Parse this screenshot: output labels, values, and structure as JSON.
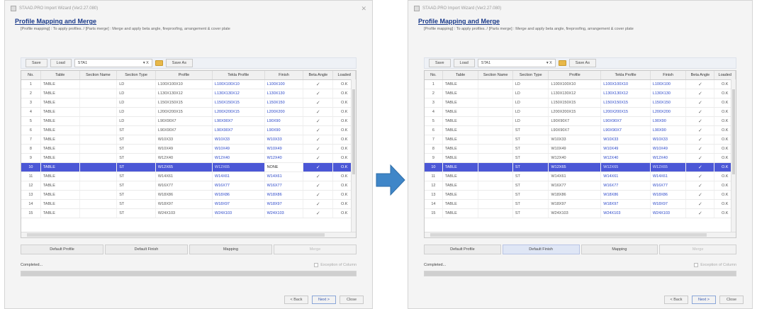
{
  "windows": [
    {
      "title": "STAAD.PRO Import Wizard (Ver2.27.080)",
      "heading": "Profile Mapping and Merge",
      "description": "[Profile mapping] : To apply profiles. / [Parts merge] : Merge and apply beta angle, fireproofing, arrangement & cover plate",
      "toolbar": {
        "save": "Save",
        "load": "Load",
        "combo_value": "STA1",
        "combo_suffix": "▾ X",
        "save_as": "Save As"
      },
      "columns": [
        "No.",
        "Table",
        "Section Name",
        "Section Type",
        "Profile",
        "Tekla Profile",
        "Finish",
        "Beta Angle",
        "Loaded"
      ],
      "rows": [
        [
          "1",
          "TABLE",
          "",
          "LD",
          "L100X100X10",
          "L100X100X10",
          "L100X100",
          "✓",
          "O.K"
        ],
        [
          "2",
          "TABLE",
          "",
          "LD",
          "L130X130X12",
          "L130X130X12",
          "L130X130",
          "✓",
          "O.K"
        ],
        [
          "3",
          "TABLE",
          "",
          "LD",
          "L150X150X15",
          "L150X150X15",
          "L150X150",
          "✓",
          "O.K"
        ],
        [
          "4",
          "TABLE",
          "",
          "LD",
          "L200X200X15",
          "L200X200X15",
          "L200X200",
          "✓",
          "O.K"
        ],
        [
          "5",
          "TABLE",
          "",
          "LD",
          "L90X90X7",
          "L90X90X7",
          "L90X90",
          "✓",
          "O.K"
        ],
        [
          "6",
          "TABLE",
          "",
          "ST",
          "L90X90X7",
          "L90X90X7",
          "L90X90",
          "✓",
          "O.K"
        ],
        [
          "7",
          "TABLE",
          "",
          "ST",
          "W10X33",
          "W10X33",
          "W10X33",
          "✓",
          "O.K"
        ],
        [
          "8",
          "TABLE",
          "",
          "ST",
          "W10X49",
          "W10X49",
          "W10X49",
          "✓",
          "O.K"
        ],
        [
          "9",
          "TABLE",
          "",
          "ST",
          "W12X40",
          "W12X40",
          "W12X40",
          "✓",
          "O.K"
        ],
        [
          "10",
          "TABLE",
          "",
          "ST",
          "W12X65",
          "W12X65",
          "NONE",
          "✓",
          "O.K"
        ],
        [
          "11",
          "TABLE",
          "",
          "ST",
          "W14X61",
          "W14X61",
          "W14X61",
          "✓",
          "O.K"
        ],
        [
          "12",
          "TABLE",
          "",
          "ST",
          "W16X77",
          "W16X77",
          "W16X77",
          "✓",
          "O.K"
        ],
        [
          "13",
          "TABLE",
          "",
          "ST",
          "W18X86",
          "W18X86",
          "W18X86",
          "✓",
          "O.K"
        ],
        [
          "14",
          "TABLE",
          "",
          "ST",
          "W18X97",
          "W18X97",
          "W18X97",
          "✓",
          "O.K"
        ],
        [
          "15",
          "TABLE",
          "",
          "ST",
          "W24X103",
          "W24X103",
          "W24X103",
          "✓",
          "O.K"
        ]
      ],
      "actions": [
        "Default Profile",
        "Default Finish",
        "Mapping",
        "Merge"
      ],
      "status": "Completed...",
      "exception_label": "Exception of Column",
      "nav": {
        "back": "< Back",
        "next": "Next >",
        "close": "Close"
      }
    },
    {
      "title": "STAAD.PRO Import Wizard (Ver2.27.080)",
      "heading": "Profile Mapping and Merge",
      "description": "[Profile mapping] : To apply profiles. / [Parts merge] : Merge and apply beta angle, fireproofing, arrangement & cover plate",
      "toolbar": {
        "save": "Save",
        "load": "Load",
        "combo_value": "STA1",
        "combo_suffix": "▾ X",
        "save_as": "Save As"
      },
      "columns": [
        "No.",
        "Table",
        "Section Name",
        "Section Type",
        "Profile",
        "Tekla Profile",
        "Finish",
        "Beta Angle",
        "Loaded"
      ],
      "rows": [
        [
          "1",
          "TABLE",
          "",
          "LD",
          "L100X100X10",
          "L100X100X10",
          "L100X100",
          "✓",
          "O.K"
        ],
        [
          "2",
          "TABLE",
          "",
          "LD",
          "L130X130X12",
          "L130X130X12",
          "L130X130",
          "✓",
          "O.K"
        ],
        [
          "3",
          "TABLE",
          "",
          "LD",
          "L150X150X15",
          "L150X150X15",
          "L150X150",
          "✓",
          "O.K"
        ],
        [
          "4",
          "TABLE",
          "",
          "LD",
          "L200X200X15",
          "L200X200X15",
          "L200X200",
          "✓",
          "O.K"
        ],
        [
          "5",
          "TABLE",
          "",
          "LD",
          "L90X90X7",
          "L90X90X7",
          "L90X90",
          "✓",
          "O.K"
        ],
        [
          "6",
          "TABLE",
          "",
          "ST",
          "L90X90X7",
          "L90X90X7",
          "L90X90",
          "✓",
          "O.K"
        ],
        [
          "7",
          "TABLE",
          "",
          "ST",
          "W10X33",
          "W10X33",
          "W10X33",
          "✓",
          "O.K"
        ],
        [
          "8",
          "TABLE",
          "",
          "ST",
          "W10X49",
          "W10X49",
          "W10X49",
          "✓",
          "O.K"
        ],
        [
          "9",
          "TABLE",
          "",
          "ST",
          "W12X40",
          "W12X40",
          "W12X40",
          "✓",
          "O.K"
        ],
        [
          "10",
          "TABLE",
          "",
          "ST",
          "W12X65",
          "W12X65",
          "W12X65",
          "✓",
          "O.K"
        ],
        [
          "11",
          "TABLE",
          "",
          "ST",
          "W14X61",
          "W14X61",
          "W14X61",
          "✓",
          "O.K"
        ],
        [
          "12",
          "TABLE",
          "",
          "ST",
          "W16X77",
          "W16X77",
          "W16X77",
          "✓",
          "O.K"
        ],
        [
          "13",
          "TABLE",
          "",
          "ST",
          "W18X86",
          "W18X86",
          "W18X86",
          "✓",
          "O.K"
        ],
        [
          "14",
          "TABLE",
          "",
          "ST",
          "W18X97",
          "W18X97",
          "W18X97",
          "✓",
          "O.K"
        ],
        [
          "15",
          "TABLE",
          "",
          "ST",
          "W24X103",
          "W24X103",
          "W24X103",
          "✓",
          "O.K"
        ]
      ],
      "actions": [
        "Default Profile",
        "Default Finish",
        "Mapping",
        "Merge"
      ],
      "status": "Completed...",
      "exception_label": "Exception of Column",
      "nav": {
        "back": "< Back",
        "next": "Next >",
        "close": "Close"
      }
    }
  ],
  "colors": {
    "selection": "#4b57d6",
    "link_text": "#2b47c8",
    "arrow": "#3f86c8"
  },
  "selected_row": "10",
  "active_action": {
    "window_1": "Default Finish"
  }
}
